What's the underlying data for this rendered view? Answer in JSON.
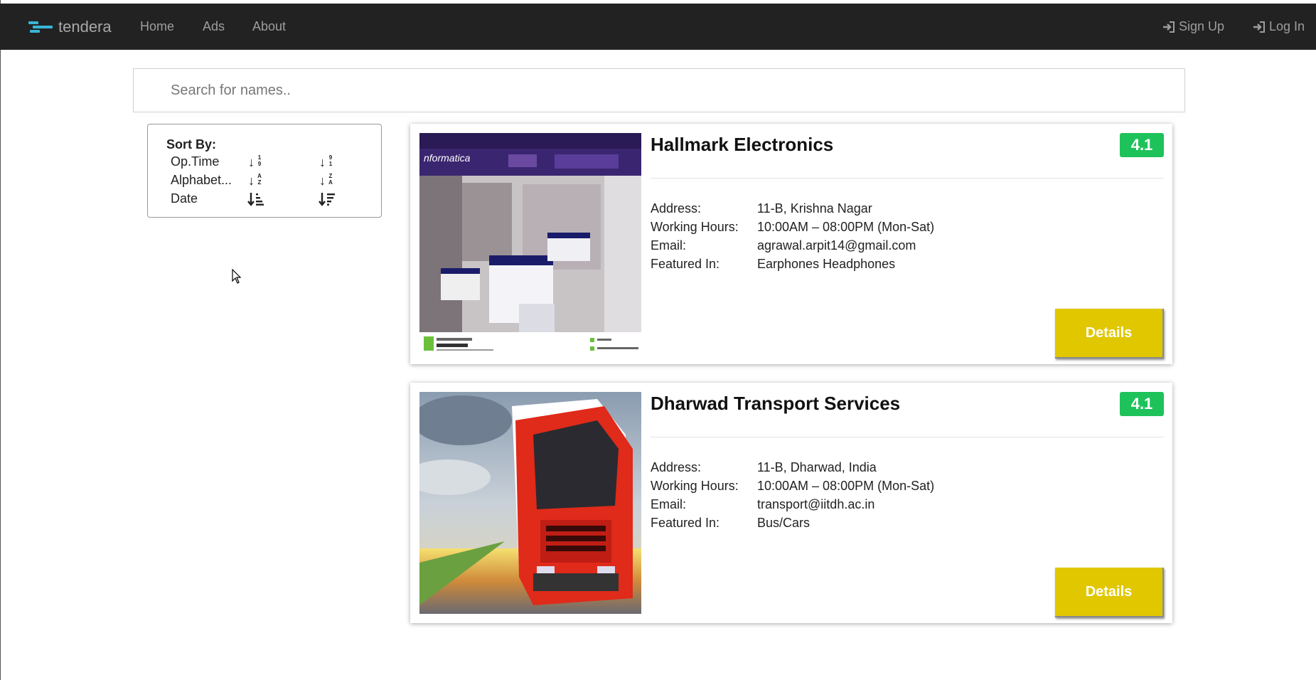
{
  "nav": {
    "brand": "tendera",
    "links": [
      "Home",
      "Ads",
      "About"
    ],
    "signup": "Sign Up",
    "login": "Log In"
  },
  "search": {
    "placeholder": "Search for names.."
  },
  "sort": {
    "title": "Sort By:",
    "rows": [
      {
        "label": "Op.Time",
        "asc_icon": "sort-numeric-ascending-icon",
        "desc_icon": "sort-numeric-descending-icon"
      },
      {
        "label": "Alphabet...",
        "asc_icon": "sort-alpha-ascending-icon",
        "desc_icon": "sort-alpha-descending-icon"
      },
      {
        "label": "Date",
        "asc_icon": "sort-amount-ascending-icon",
        "desc_icon": "sort-amount-descending-icon"
      }
    ]
  },
  "listings": [
    {
      "name": "Hallmark Electronics",
      "rating": "4.1",
      "address_label": "Address:",
      "address": "11-B, Krishna Nagar",
      "hours_label": "Working Hours:",
      "hours": "10:00AM – 08:00PM (Mon-Sat)",
      "email_label": "Email:",
      "email": "agrawal.arpit14@gmail.com",
      "featured_label": "Featured In:",
      "featured": "Earphones Headphones",
      "image": "electronics-store-photo",
      "details": "Details"
    },
    {
      "name": "Dharwad Transport Services",
      "rating": "4.1",
      "address_label": "Address:",
      "address": "11-B, Dharwad, India",
      "hours_label": "Working Hours:",
      "hours": "10:00AM – 08:00PM (Mon-Sat)",
      "email_label": "Email:",
      "email": "transport@iitdh.ac.in",
      "featured_label": "Featured In:",
      "featured": "Bus/Cars",
      "image": "red-truck-photo",
      "details": "Details"
    }
  ],
  "colors": {
    "navbar": "#222222",
    "rating_badge": "#1ec25a",
    "details_button": "#e0c700"
  }
}
